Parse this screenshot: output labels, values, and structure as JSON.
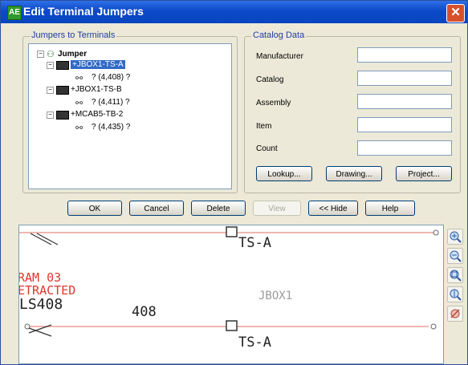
{
  "window": {
    "title": "Edit Terminal Jumpers",
    "icon_text": "AE",
    "close_glyph": "✕"
  },
  "jumpers_group": {
    "label": "Jumpers to Terminals"
  },
  "tree": {
    "root_label": "Jumper",
    "nodes": [
      {
        "label": "+JBOX1-TS-A",
        "selected": true,
        "child": "? (4,408) ?"
      },
      {
        "label": "+JBOX1-TS-B",
        "selected": false,
        "child": "? (4,411) ?"
      },
      {
        "label": "+MCAB5-TB-2",
        "selected": false,
        "child": "? (4,435) ?"
      }
    ]
  },
  "catalog_group": {
    "label": "Catalog Data",
    "fields": [
      {
        "label": "Manufacturer",
        "value": ""
      },
      {
        "label": "Catalog",
        "value": ""
      },
      {
        "label": "Assembly",
        "value": ""
      },
      {
        "label": "Item",
        "value": ""
      },
      {
        "label": "Count",
        "value": ""
      }
    ],
    "buttons": {
      "lookup": "Lookup...",
      "drawing": "Drawing...",
      "project": "Project..."
    }
  },
  "buttons": {
    "ok": "OK",
    "cancel": "Cancel",
    "delete": "Delete",
    "view": "View",
    "hide": "<< Hide",
    "help": "Help"
  },
  "drawing": {
    "labels": {
      "ts_top": "TS-A",
      "ram": "RAM 03",
      "tracted": "ETRACTED",
      "ls": "LS408",
      "wire": "408",
      "box": "JBOX1",
      "ts_bottom": "TS-A"
    }
  },
  "colors": {
    "title_bar": "#0b49c9",
    "selection": "#316ac5",
    "wire_line": "#e8a194",
    "red_text": "#e1362e"
  },
  "icons": {
    "zoom": [
      "zoom-in-icon",
      "zoom-out-icon",
      "zoom-window-icon",
      "zoom-realtime-icon",
      "pan-icon"
    ]
  }
}
